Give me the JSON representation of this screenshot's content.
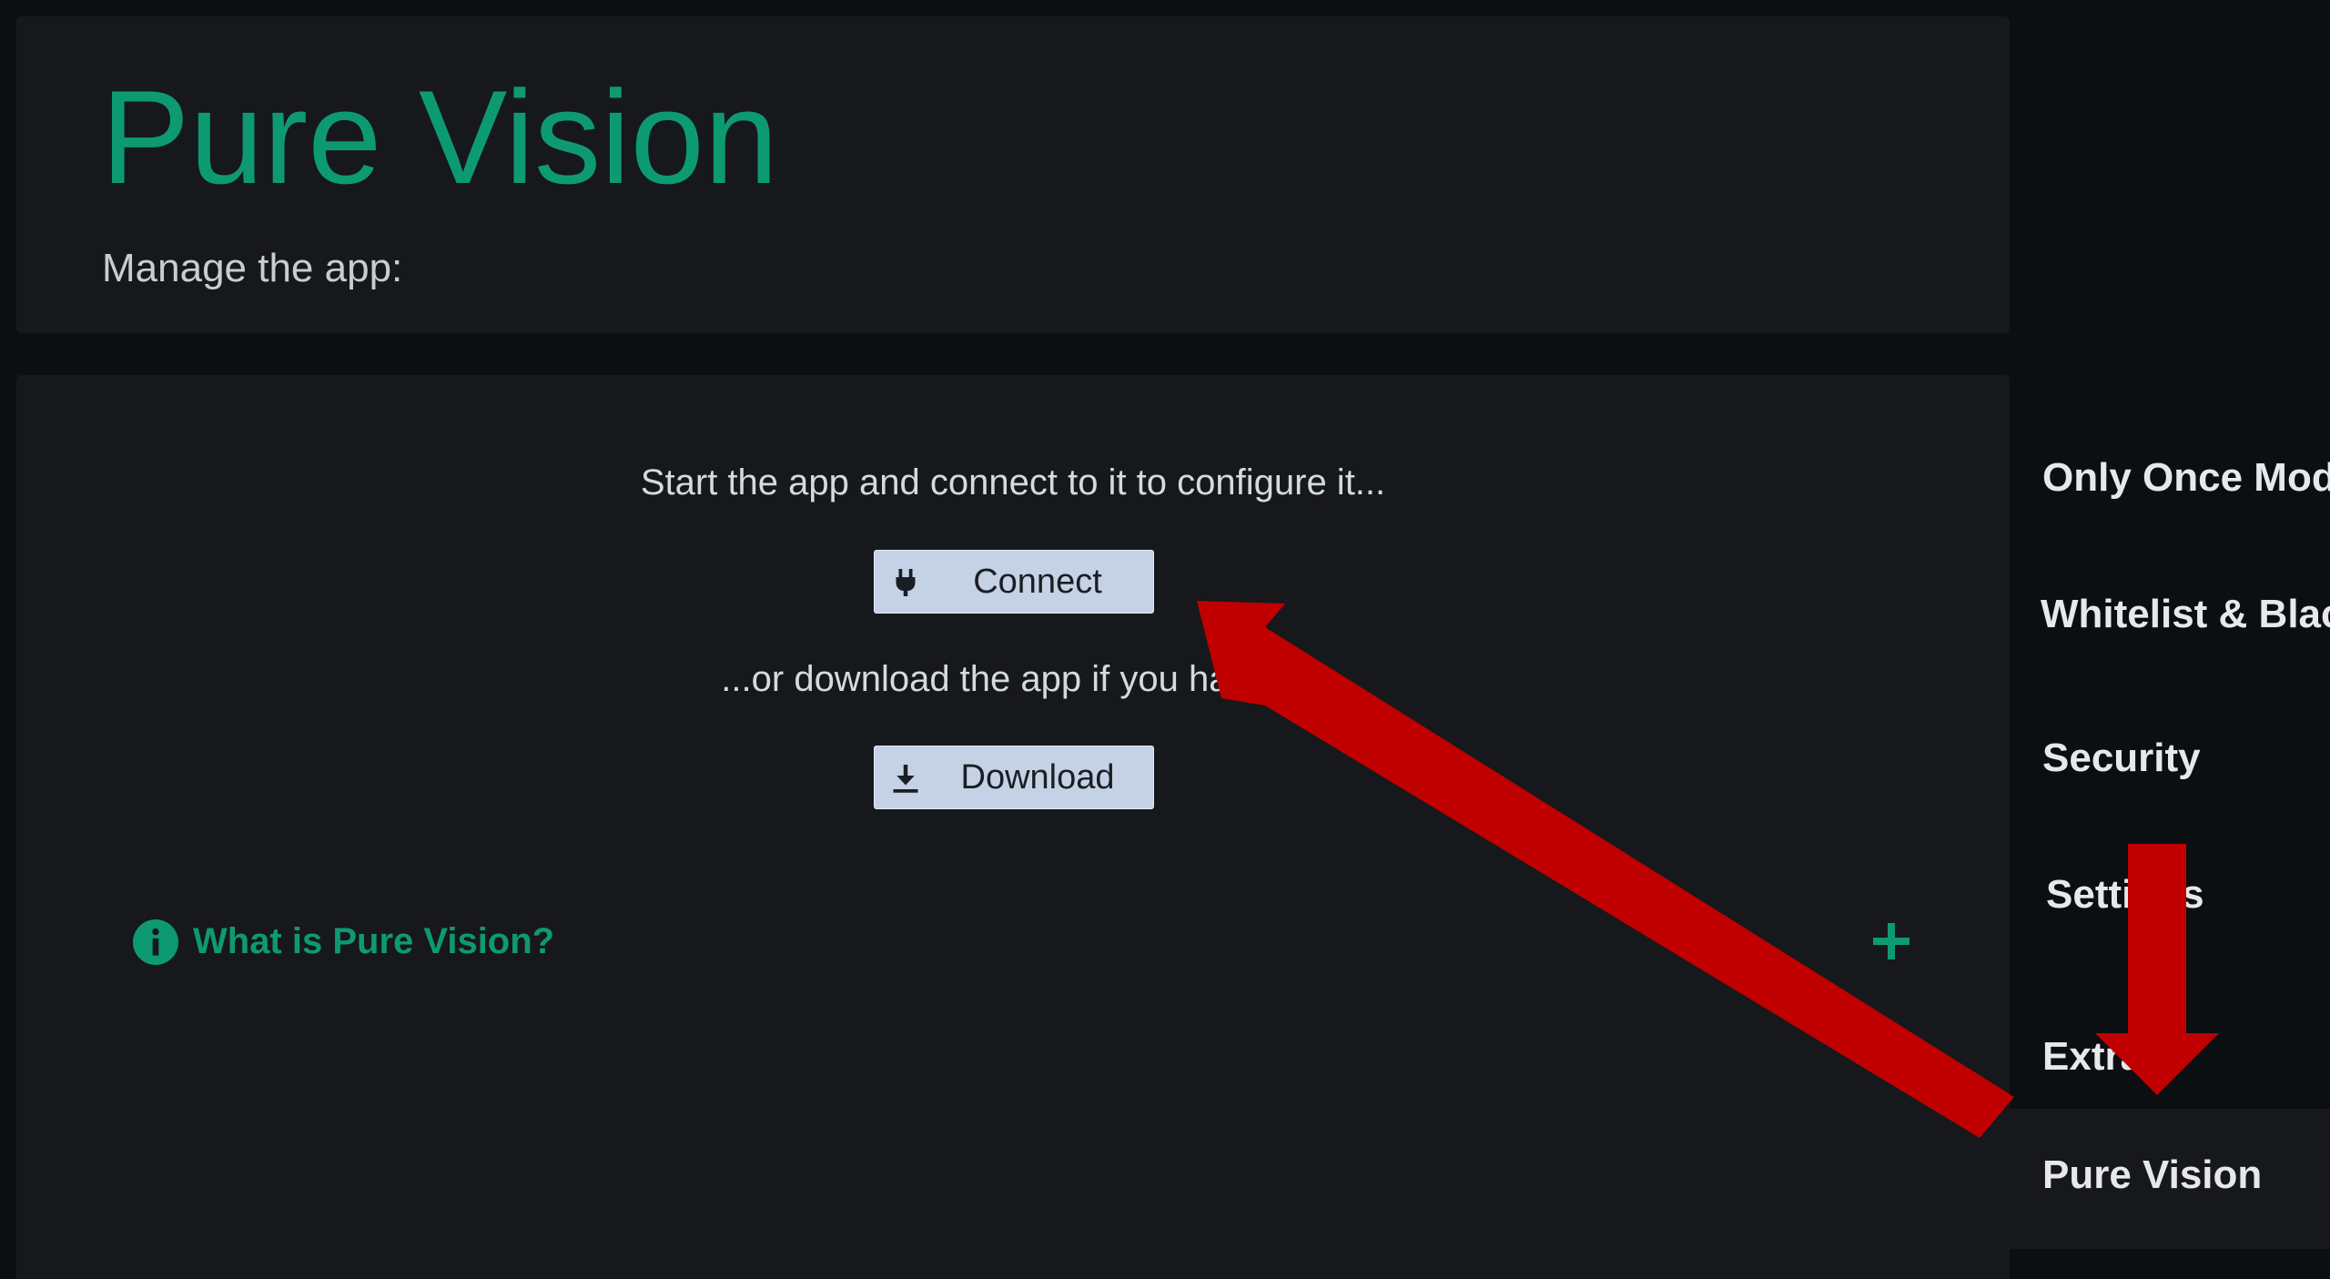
{
  "header": {
    "title": "Pure Vision",
    "subtitle": "Manage the app:"
  },
  "main": {
    "intro_text": "Start the app and connect to it to configure it...",
    "connect_label": "Connect",
    "alt_text": "...or download the app if you haven't",
    "download_label": "Download",
    "faq_title": "What is Pure Vision?"
  },
  "sidebar": {
    "items": [
      {
        "label": "Only Once Mode",
        "active": false
      },
      {
        "label": "Whitelist & Blacklist",
        "active": false
      },
      {
        "label": "Security",
        "active": false
      },
      {
        "label": "Settings",
        "active": false
      },
      {
        "label": "Extras",
        "active": false
      },
      {
        "label": "Pure Vision",
        "active": true
      }
    ]
  },
  "icons": {
    "connect": "plug-icon",
    "download": "download-icon",
    "info": "info-icon",
    "expand": "plus-icon"
  },
  "colors": {
    "accent": "#0d9a72",
    "button_bg": "#c5d2e6",
    "annotation_arrow": "#c00000",
    "panel_bg": "#17181b",
    "page_bg": "#0c0f12"
  }
}
